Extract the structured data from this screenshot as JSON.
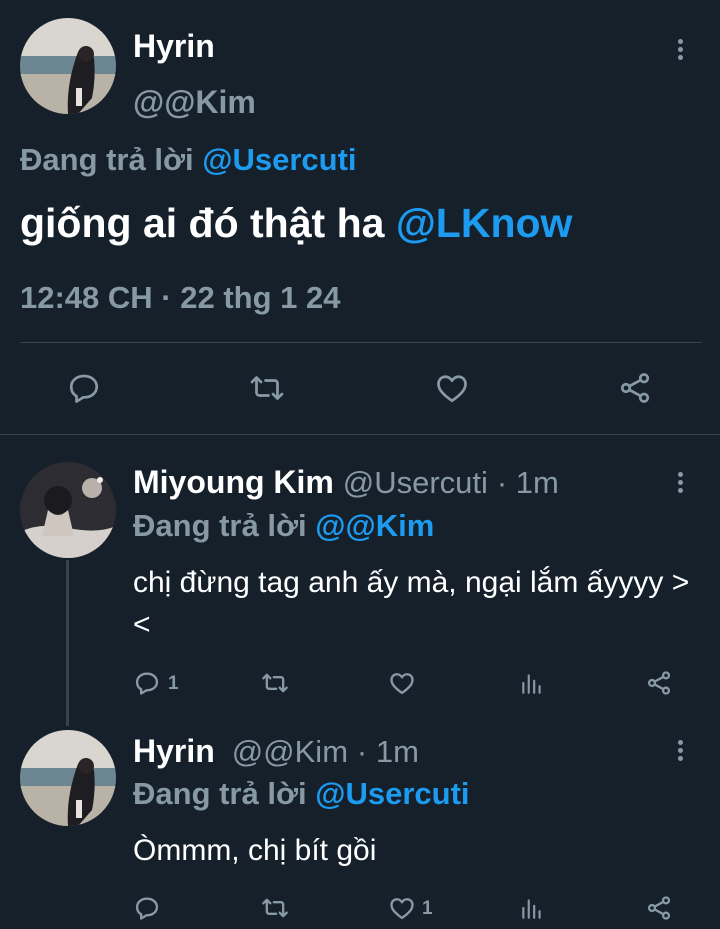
{
  "main_tweet": {
    "author_name": "Hyrin",
    "author_handle": "@@Kim",
    "replying_label": "Đang trả lời",
    "replying_to": "@Usercuti",
    "text": "giống ai đó thật ha",
    "mention": "@LKnow",
    "timestamp": "12:48 CH · 22 thg 1 24",
    "actions": [
      "reply-icon",
      "retweet-icon",
      "like-icon",
      "share-icon"
    ]
  },
  "replies": [
    {
      "author_name": "Miyoung Kim",
      "author_handle": "@Usercuti",
      "age": "· 1m",
      "replying_label": "Đang trả lời",
      "replying_to": "@@Kim",
      "text": "chị đừng tag anh ấy mà, ngại lắm ấyyyy ><",
      "reply_count": "1",
      "like_count": ""
    },
    {
      "author_name": "Hyrin",
      "author_handle": "@@Kim",
      "age": "· 1m",
      "replying_label": "Đang trả lời",
      "replying_to": "@Usercuti",
      "text": "Òmmm, chị bít gồi",
      "reply_count": "",
      "like_count": "1"
    }
  ],
  "colors": {
    "background": "#15202b",
    "text": "#ffffff",
    "muted": "#8899a6",
    "accent": "#1d9bf0",
    "divider": "#38444d"
  }
}
